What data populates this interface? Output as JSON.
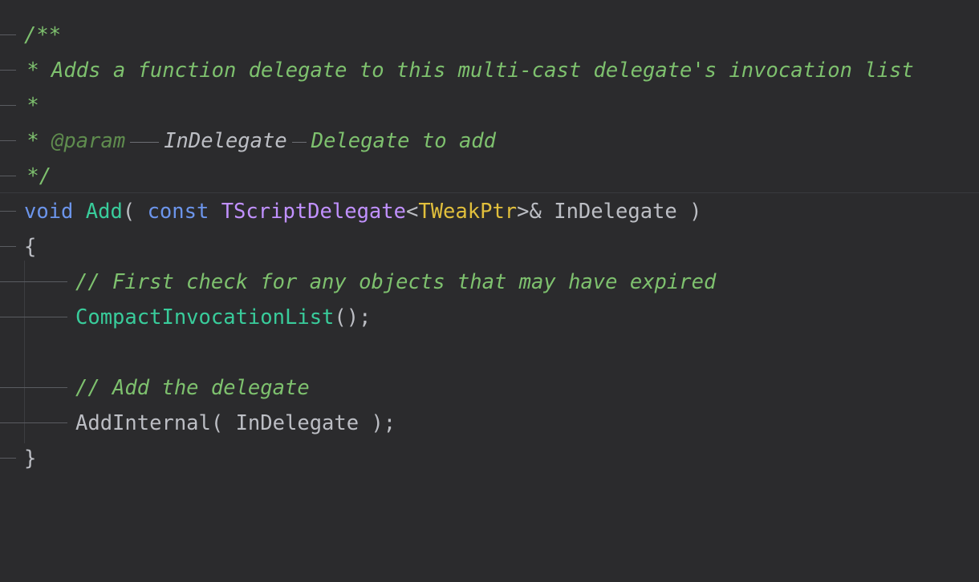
{
  "editor": {
    "lines": [
      {
        "id": 1,
        "text": "/**"
      },
      {
        "id": 2,
        "text": " * Adds a function delegate to this multi-cast delegate's invocation list"
      },
      {
        "id": 3,
        "text": " *"
      },
      {
        "id": 4,
        "parts": [
          " * ",
          "@param",
          "InDelegate",
          "Delegate to add"
        ]
      },
      {
        "id": 5,
        "text": " */"
      },
      {
        "id": 6,
        "parts": [
          "void",
          " ",
          "Add",
          "( ",
          "const",
          " ",
          "TScriptDelegate",
          "<",
          "TWeakPtr",
          ">& InDelegate )"
        ]
      },
      {
        "id": 7,
        "text": "{"
      },
      {
        "id": 8,
        "text": "// First check for any objects that may have expired"
      },
      {
        "id": 9,
        "parts": [
          "CompactInvocationList",
          "();"
        ]
      },
      {
        "id": 10,
        "text": ""
      },
      {
        "id": 11,
        "text": "// Add the delegate"
      },
      {
        "id": 12,
        "text": "AddInternal( InDelegate );"
      },
      {
        "id": 13,
        "text": "}"
      }
    ]
  },
  "colors": {
    "background": "#2b2b2d",
    "comment": "#7ec16e",
    "keyword": "#6c95eb",
    "function": "#39cc9b",
    "type": "#c191ff",
    "template_arg": "#e1bf3c",
    "plain": "#bcbec4"
  }
}
